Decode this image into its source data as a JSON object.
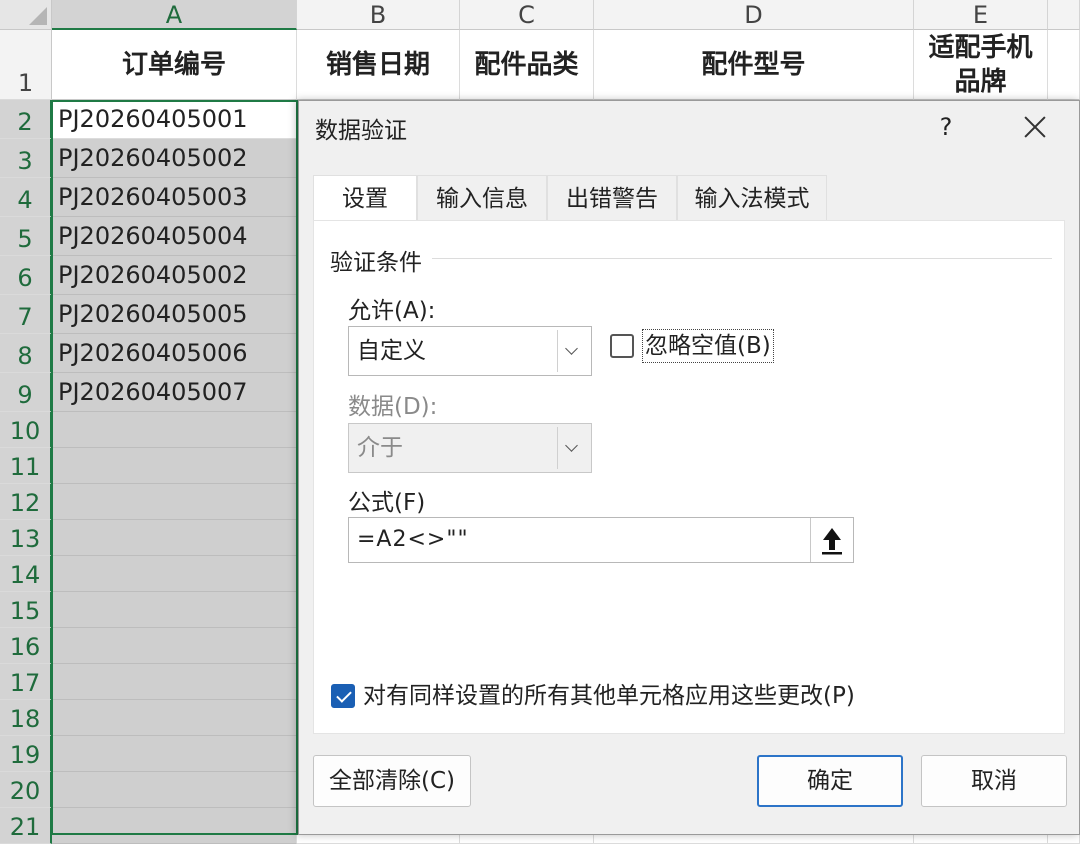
{
  "sheet": {
    "columns": [
      "A",
      "B",
      "C",
      "D",
      "E"
    ],
    "row_numbers": [
      "1",
      "2",
      "3",
      "4",
      "5",
      "6",
      "7",
      "8",
      "9",
      "10",
      "11",
      "12",
      "13",
      "14",
      "15",
      "16",
      "17",
      "18",
      "19",
      "20",
      "21"
    ],
    "headers": [
      "订单编号",
      "销售日期",
      "配件品类",
      "配件型号",
      "适配手机品牌"
    ],
    "column_a_values": [
      "PJ20260405001",
      "PJ20260405002",
      "PJ20260405003",
      "PJ20260405004",
      "PJ20260405002",
      "PJ20260405005",
      "PJ20260405006",
      "PJ20260405007"
    ]
  },
  "dialog": {
    "title": "数据验证",
    "help_label": "?",
    "tabs": [
      "设置",
      "输入信息",
      "出错警告",
      "输入法模式"
    ],
    "active_tab": "设置",
    "group_title": "验证条件",
    "allow_label": "允许(A):",
    "allow_value": "自定义",
    "ignore_blank_label": "忽略空值(B)",
    "ignore_blank_checked": false,
    "data_label": "数据(D):",
    "data_value": "介于",
    "formula_label": "公式(F)",
    "formula_value": "=A2<>\"\"",
    "apply_all_label": "对有同样设置的所有其他单元格应用这些更改(P)",
    "apply_all_checked": true,
    "clear_all_button": "全部清除(C)",
    "ok_button": "确定",
    "cancel_button": "取消"
  },
  "icons": {
    "collapse": "up-arrow-icon",
    "close": "close-icon",
    "dropdown": "chevron-down-icon"
  },
  "colors": {
    "selection_green": "#1f7a45",
    "checkbox_blue": "#1a5fb4",
    "default_button_border": "#2c74c8"
  }
}
